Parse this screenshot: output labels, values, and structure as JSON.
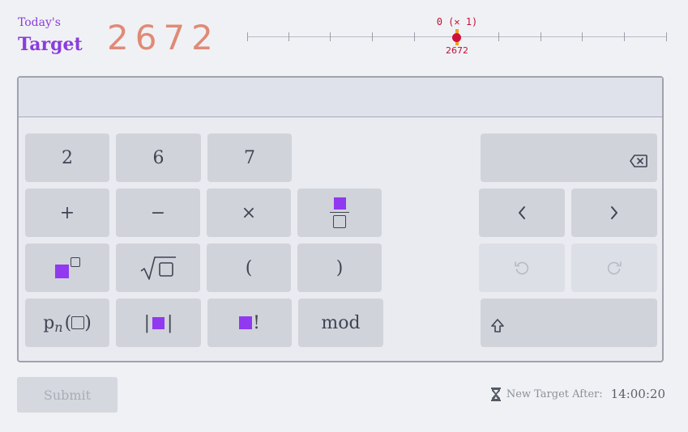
{
  "header": {
    "todays": "Today's",
    "target_label": "Target",
    "target_value": "2672"
  },
  "scale": {
    "marker_top": "0 (✕ 1)",
    "marker_bottom": "2672",
    "tick_count": 11
  },
  "keys": {
    "num1": "2",
    "num2": "6",
    "num3": "7",
    "plus": "+",
    "minus": "−",
    "times": "×",
    "lparen": "(",
    "rparen": ")",
    "mod": "mod",
    "partition_p": "p",
    "partition_n": "n"
  },
  "footer": {
    "submit": "Submit",
    "timer_label": "New Target After:",
    "timer_value": "14:00:20"
  }
}
